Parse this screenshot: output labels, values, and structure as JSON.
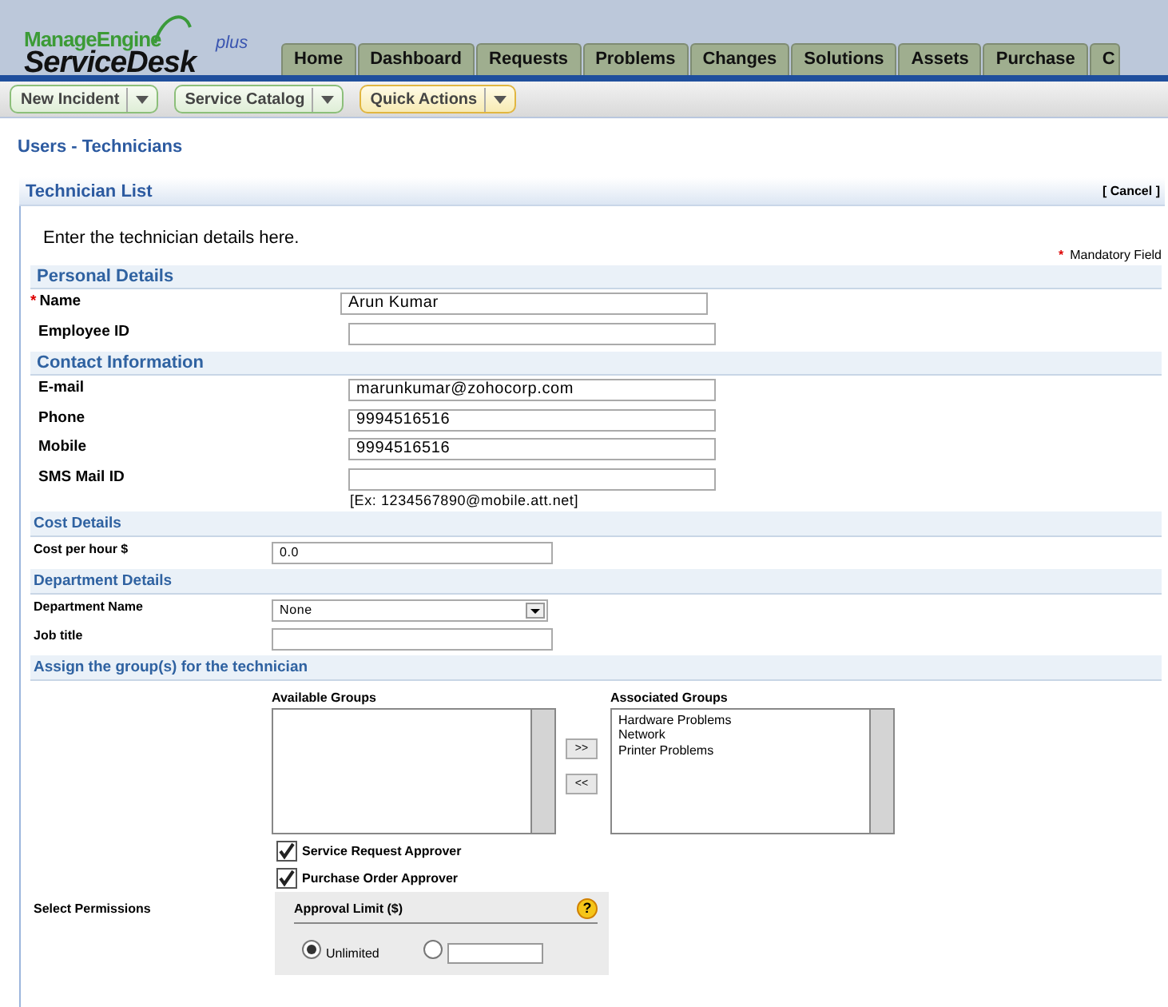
{
  "header": {
    "logo": {
      "brand": "ManageEngine",
      "product": "ServiceDesk",
      "edition": "plus"
    },
    "tabs": [
      {
        "label": "Home"
      },
      {
        "label": "Dashboard"
      },
      {
        "label": "Requests"
      },
      {
        "label": "Problems"
      },
      {
        "label": "Changes"
      },
      {
        "label": "Solutions"
      },
      {
        "label": "Assets"
      },
      {
        "label": "Purchase"
      },
      {
        "label": "C"
      }
    ]
  },
  "toolbar": [
    {
      "label": "New Incident",
      "kind": "standard"
    },
    {
      "label": "Service Catalog",
      "kind": "standard"
    },
    {
      "label": "Quick Actions",
      "kind": "highlight"
    }
  ],
  "breadcrumb": "Users - Technicians",
  "panel": {
    "title": "Technician List",
    "cancel": "[ Cancel ]",
    "intro": "Enter the technician details here.",
    "mandatory_mark": "*",
    "mandatory_note": "Mandatory Field",
    "sections": [
      {
        "title": "Personal Details",
        "kind": "major",
        "fields": [
          {
            "label": "Name",
            "kind": "text",
            "value": "Arun Kumar",
            "required": true
          },
          {
            "label": "Employee ID",
            "kind": "text",
            "required": false
          }
        ]
      },
      {
        "title": "Contact Information",
        "kind": "major",
        "fields": [
          {
            "label": "E-mail",
            "kind": "text",
            "value": "marunkumar@zohocorp.com",
            "required": false
          },
          {
            "label": "Phone",
            "kind": "text",
            "value": "9994516516",
            "required": false
          },
          {
            "label": "Mobile",
            "kind": "text",
            "value": "9994516516",
            "required": false
          },
          {
            "label": "SMS Mail ID",
            "kind": "text",
            "hint": "[Ex: 1234567890@mobile.att.net]",
            "required": false
          }
        ]
      },
      {
        "title": "Cost Details",
        "kind": "minor",
        "fields": [
          {
            "label": "Cost per hour $",
            "kind": "text",
            "value": "0.0",
            "required": false
          }
        ]
      },
      {
        "title": "Department Details",
        "kind": "minor",
        "fields": [
          {
            "label": "Department Name",
            "kind": "select",
            "value": "None",
            "required": false
          },
          {
            "label": "Job title",
            "kind": "text",
            "required": false
          }
        ]
      },
      {
        "title": "Assign the group(s) for the technician",
        "kind": "minor"
      }
    ],
    "groups": {
      "available": {
        "label": "Available Groups"
      },
      "associated": {
        "label": "Associated Groups",
        "items": [
          "Hardware Problems",
          "Network",
          "Printer Problems"
        ]
      },
      "add": ">>",
      "remove": "<<"
    },
    "approvers": [
      {
        "label": "Service Request Approver",
        "checked": true
      },
      {
        "label": "Purchase Order Approver",
        "checked": true
      }
    ],
    "permissions": {
      "label": "Select Permissions",
      "title": "Approval Limit ($)",
      "help": "?",
      "options": [
        {
          "label": "Unlimited",
          "kind": "plain",
          "selected": true
        },
        {
          "kind": "amount",
          "selected": false
        }
      ]
    }
  }
}
